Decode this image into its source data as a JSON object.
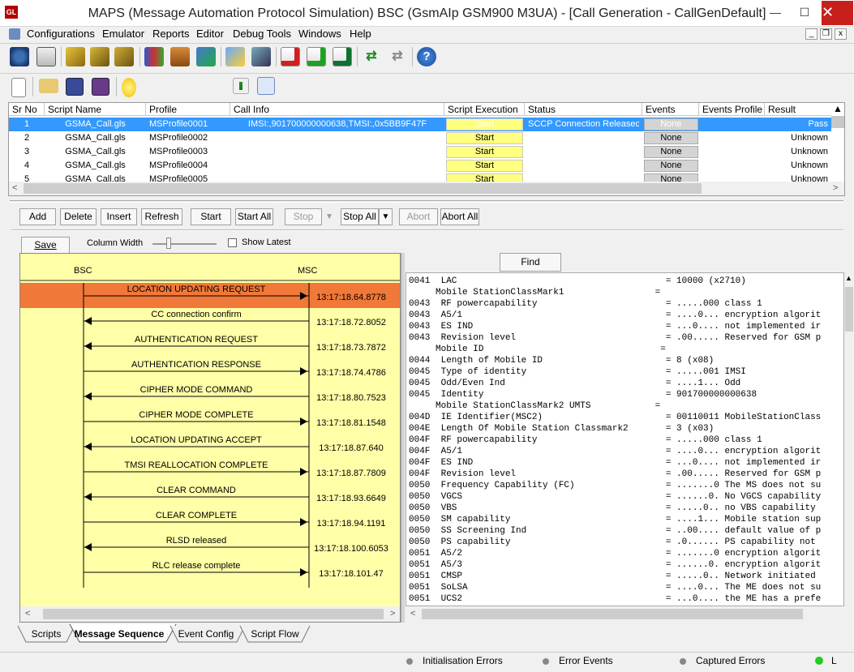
{
  "window": {
    "title": "MAPS (Message Automation Protocol Simulation) BSC (GsmAIp GSM900 M3UA) - [Call Generation  - CallGenDefault]",
    "logo_text": "GL",
    "min": "—",
    "max": "☐",
    "close": "✕"
  },
  "menu": [
    "Configurations",
    "Emulator",
    "Reports",
    "Editor",
    "Debug Tools",
    "Windows",
    "Help"
  ],
  "grid": {
    "headers": [
      "Sr No",
      "Script Name",
      "Profile",
      "Call Info",
      "Script Execution",
      "Status",
      "Events",
      "Events Profile",
      "Result"
    ],
    "rows": [
      {
        "sr": "1",
        "script": "GSMA_Call.gls",
        "profile": "MSProfile0001",
        "callinfo": "IMSI:,901700000000638,TMSI:,0x5BB9F47F",
        "exec": "Start",
        "status": "SCCP Connection Released",
        "events": "None",
        "result": "Pass"
      },
      {
        "sr": "2",
        "script": "GSMA_Call.gls",
        "profile": "MSProfile0002",
        "callinfo": "",
        "exec": "Start",
        "status": "",
        "events": "None",
        "result": "Unknown"
      },
      {
        "sr": "3",
        "script": "GSMA_Call.gls",
        "profile": "MSProfile0003",
        "callinfo": "",
        "exec": "Start",
        "status": "",
        "events": "None",
        "result": "Unknown"
      },
      {
        "sr": "4",
        "script": "GSMA_Call.gls",
        "profile": "MSProfile0004",
        "callinfo": "",
        "exec": "Start",
        "status": "",
        "events": "None",
        "result": "Unknown"
      },
      {
        "sr": "5",
        "script": "GSMA_Call.gls",
        "profile": "MSProfile0005",
        "callinfo": "",
        "exec": "Start",
        "status": "",
        "events": "None",
        "result": "Unknown"
      }
    ]
  },
  "actions": {
    "add": "Add",
    "delete": "Delete",
    "insert": "Insert",
    "refresh": "Refresh",
    "start": "Start",
    "start_all": "Start All",
    "stop": "Stop",
    "stop_all": "Stop All",
    "abort": "Abort",
    "abort_all": "Abort All"
  },
  "seq_controls": {
    "save": "Save",
    "column_width": "Column Width",
    "show_latest": "Show Latest",
    "find": "Find"
  },
  "sequence": {
    "left_label": "BSC",
    "right_label": "MSC",
    "messages": [
      {
        "label": "LOCATION UPDATING REQUEST",
        "time": "13:17:18.64.8778",
        "dir": "right",
        "highlight": true
      },
      {
        "label": "CC connection confirm",
        "time": "13:17:18.72.8052",
        "dir": "left"
      },
      {
        "label": "AUTHENTICATION REQUEST",
        "time": "13:17:18.73.7872",
        "dir": "left"
      },
      {
        "label": "AUTHENTICATION RESPONSE",
        "time": "13:17:18.74.4786",
        "dir": "right"
      },
      {
        "label": "CIPHER MODE COMMAND",
        "time": "13:17:18.80.7523",
        "dir": "left"
      },
      {
        "label": "CIPHER MODE COMPLETE",
        "time": "13:17:18.81.1548",
        "dir": "right"
      },
      {
        "label": "LOCATION UPDATING ACCEPT",
        "time": "13:17:18.87.640",
        "dir": "left"
      },
      {
        "label": "TMSI REALLOCATION COMPLETE",
        "time": "13:17:18.87.7809",
        "dir": "right"
      },
      {
        "label": "CLEAR COMMAND",
        "time": "13:17:18.93.6649",
        "dir": "left"
      },
      {
        "label": "CLEAR COMPLETE",
        "time": "13:17:18.94.1191",
        "dir": "right"
      },
      {
        "label": "RLSD released",
        "time": "13:17:18.100.6053",
        "dir": "left"
      },
      {
        "label": "RLC release complete",
        "time": "13:17:18.101.47",
        "dir": "right"
      }
    ]
  },
  "detail_lines": [
    "0041  LAC                                       = 10000 (x2710)",
    "     Mobile StationClassMark1                 =",
    "0043  RF powercapability                        = .....000 class 1",
    "0043  A5/1                                      = ....0... encryption algorit",
    "0043  ES IND                                    = ...0.... not implemented ir",
    "0043  Revision level                            = .00..... Reserved for GSM p",
    "     Mobile ID                                 =",
    "0044  Length of Mobile ID                       = 8 (x08)",
    "0045  Type of identity                          = .....001 IMSI",
    "0045  Odd/Even Ind                              = ....1... Odd",
    "0045  Identity                                  = 901700000000638",
    "     Mobile StationClassMark2 UMTS            =",
    "004D  IE Identifier(MSC2)                       = 00110011 MobileStationClass",
    "004E  Length Of Mobile Station Classmark2       = 3 (x03)",
    "004F  RF powercapability                        = .....000 class 1",
    "004F  A5/1                                      = ....0... encryption algorit",
    "004F  ES IND                                    = ...0.... not implemented ir",
    "004F  Revision level                            = .00..... Reserved for GSM p",
    "0050  Frequency Capability (FC)                 = .......0 The MS does not su",
    "0050  VGCS                                      = ......0. No VGCS capability",
    "0050  VBS                                       = .....0.. no VBS capability",
    "0050  SM capability                             = ....1... Mobile station sup",
    "0050  SS Screening Ind                          = ..00.... default value of p",
    "0050  PS capability                             = .0...... PS capability not",
    "0051  A5/2                                      = .......0 encryption algorit",
    "0051  A5/3                                      = ......0. encryption algorit",
    "0051  CMSP                                      = .....0.. Network initiated",
    "0051  SoLSA                                     = ....0... The ME does not su",
    "0051  UCS2                                      = ...0.... the ME has a prefe"
  ],
  "tabs": [
    "Scripts",
    "Message Sequence",
    "Event Config",
    "Script Flow"
  ],
  "status": [
    "Initialisation Errors",
    "Error Events",
    "Captured Errors",
    "L"
  ],
  "colors": {
    "highlight": "#f07838",
    "seq_bg": "#ffffa8",
    "selection": "#3399ff",
    "start_btn": "#ffff80"
  }
}
